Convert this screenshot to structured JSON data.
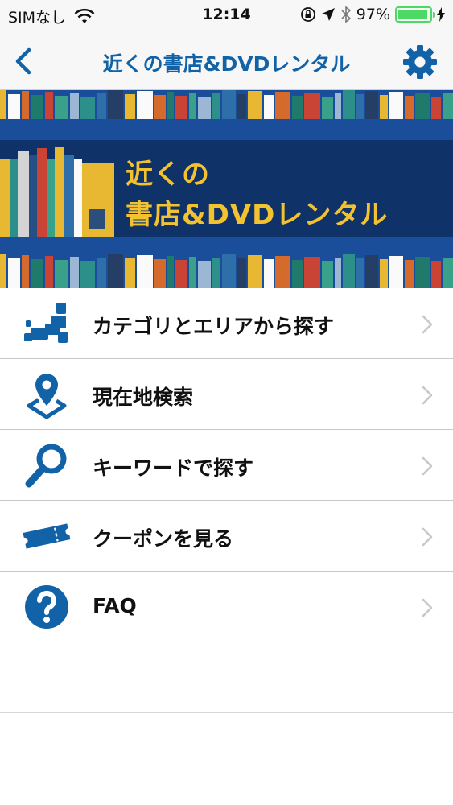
{
  "status_bar": {
    "carrier": "SIMなし",
    "time": "12:14",
    "battery_percent": "97%",
    "battery_level": 0.97
  },
  "nav": {
    "title": "近くの書店&DVDレンタル",
    "back_icon": "chevron-left-icon",
    "settings_icon": "gear-icon"
  },
  "banner": {
    "line1": "近くの",
    "line2": "書店&DVDレンタル"
  },
  "menu": {
    "items": [
      {
        "label": "カテゴリとエリアから探す",
        "icon": "japan-map-icon"
      },
      {
        "label": "現在地検索",
        "icon": "location-pin-icon"
      },
      {
        "label": "キーワードで探す",
        "icon": "magnifier-icon"
      },
      {
        "label": "クーポンを見る",
        "icon": "ticket-icon"
      },
      {
        "label": "FAQ",
        "icon": "question-icon"
      }
    ]
  },
  "colors": {
    "accent": "#1262a8",
    "banner_blue": "#1a4e9b",
    "banner_text": "#f2c230"
  }
}
